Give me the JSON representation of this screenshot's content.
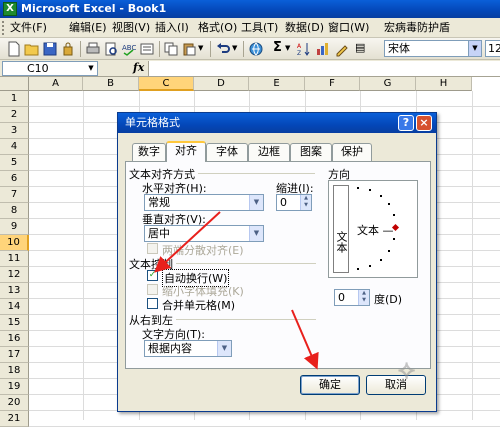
{
  "window": {
    "title": "Microsoft Excel - Book1"
  },
  "menu": [
    "文件(F)",
    "编辑(E)",
    "视图(V)",
    "插入(I)",
    "格式(O)",
    "工具(T)",
    "数据(D)",
    "窗口(W)",
    "宏病毒防护盾"
  ],
  "toolbar": {
    "font": "宋体",
    "size": "12"
  },
  "namebox": "C10",
  "fx_label": "fx",
  "columns": [
    "A",
    "B",
    "C",
    "D",
    "E",
    "F",
    "G",
    "H"
  ],
  "selected_column": "C",
  "rows": [
    "1",
    "2",
    "3",
    "4",
    "5",
    "6",
    "7",
    "8",
    "9",
    "10",
    "11",
    "12",
    "13",
    "14",
    "15",
    "16",
    "17",
    "18",
    "19",
    "20",
    "21"
  ],
  "selected_row": "10",
  "dialog": {
    "title": "单元格格式",
    "tabs": [
      "数字",
      "对齐",
      "字体",
      "边框",
      "图案",
      "保护"
    ],
    "active_tab": "对齐",
    "text_align_section": "文本对齐方式",
    "horizontal_label": "水平对齐(H):",
    "horizontal_value": "常规",
    "indent_label": "缩进(I):",
    "indent_value": "0",
    "vertical_label": "垂直对齐(V):",
    "vertical_value": "居中",
    "justify_distributed": "两端分散对齐(E)",
    "text_control_section": "文本控制",
    "wrap_text": "自动换行(W)",
    "shrink_to_fit": "缩小字体填充(K)",
    "merge_cells": "合并单元格(M)",
    "rtl_section": "从右到左",
    "text_direction_label": "文字方向(T):",
    "text_direction_value": "根据内容",
    "orientation_section": "方向",
    "orientation_vertical": "文本",
    "orientation_horizontal": "文本 —",
    "degree_value": "0",
    "degree_label": "度(D)",
    "ok_button": "确定",
    "cancel_button": "取消",
    "wrap_checked": true
  },
  "colors": {
    "title_blue": "#0447b8",
    "selection_orange": "#ffd47a",
    "arrow_red": "#e8201c",
    "check_green": "#21a121"
  }
}
